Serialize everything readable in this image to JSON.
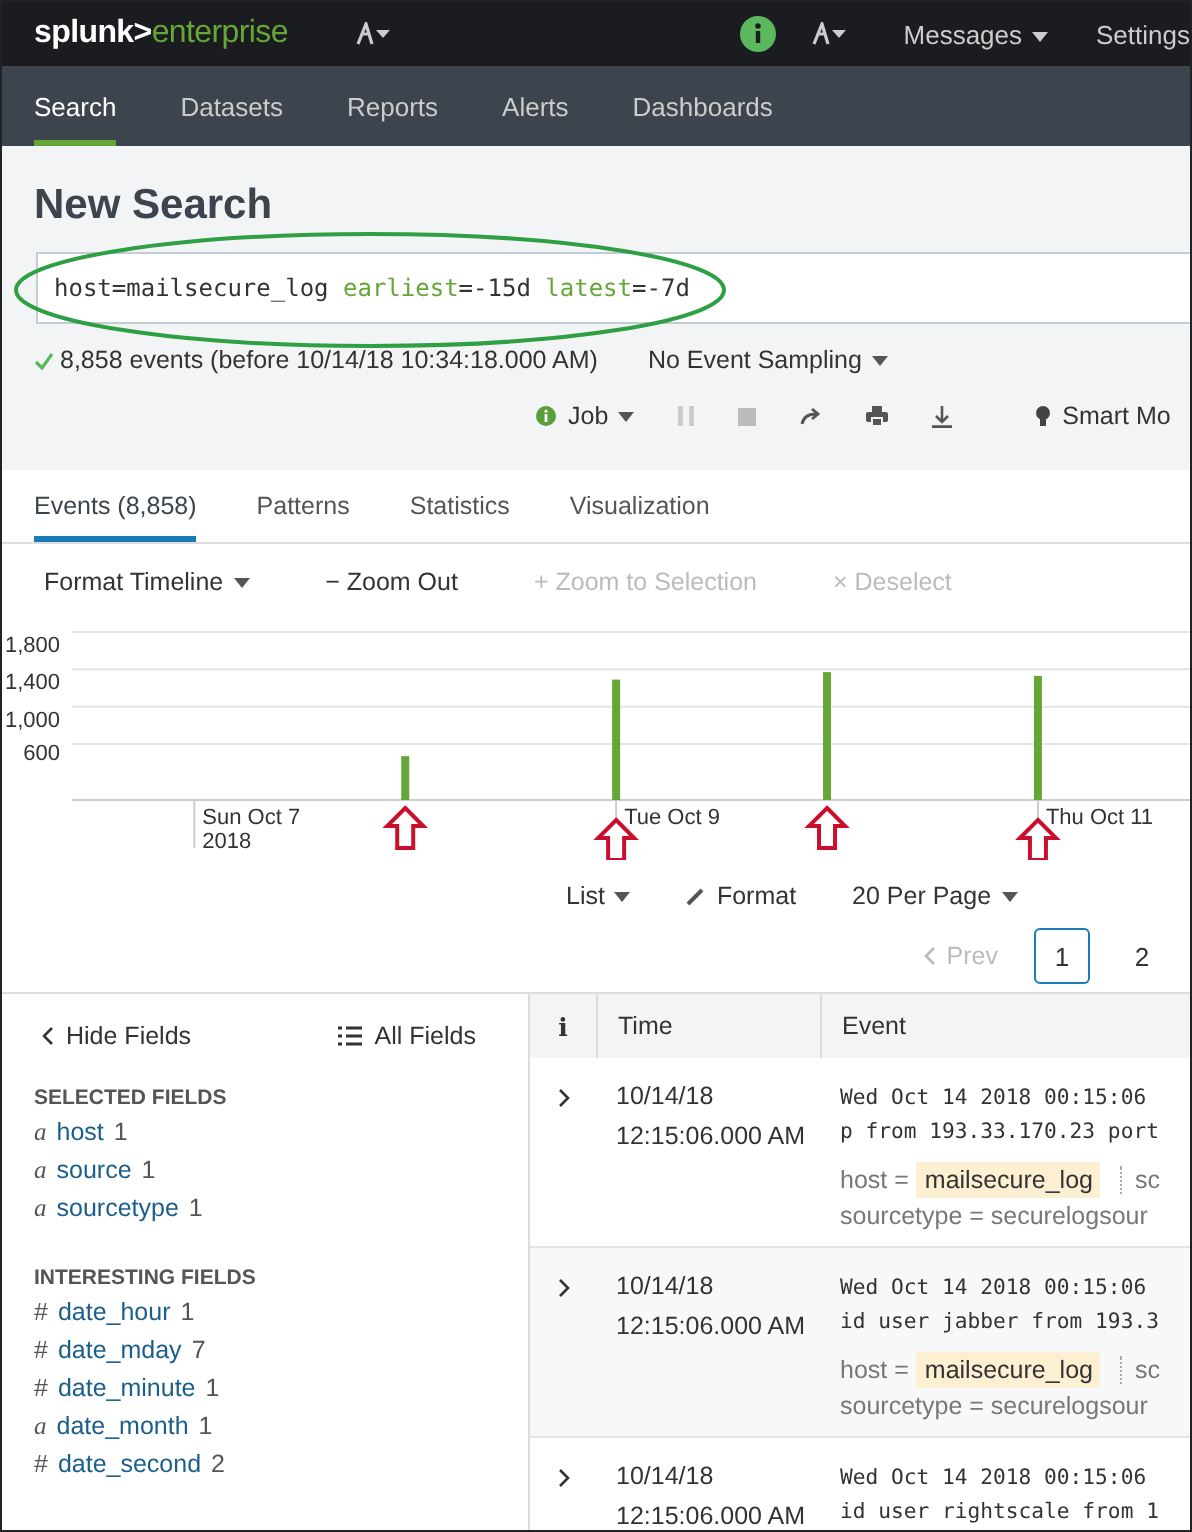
{
  "topbar": {
    "logo_left": "splunk>",
    "logo_right": "enterprise",
    "menus": [
      {
        "label": "Messages",
        "dropdown": true
      },
      {
        "label": "Settings",
        "dropdown": false
      }
    ]
  },
  "nav": [
    {
      "label": "Search",
      "selected": true
    },
    {
      "label": "Datasets",
      "selected": false
    },
    {
      "label": "Reports",
      "selected": false
    },
    {
      "label": "Alerts",
      "selected": false
    },
    {
      "label": "Dashboards",
      "selected": false
    }
  ],
  "page_title": "New Search",
  "search": [
    {
      "text": "host=mailsecure_log ",
      "kind": "plain"
    },
    {
      "text": "earliest",
      "kind": "keyword"
    },
    {
      "text": "=-15d ",
      "kind": "plain"
    },
    {
      "text": "latest",
      "kind": "keyword"
    },
    {
      "text": "=-7d",
      "kind": "plain"
    }
  ],
  "status": {
    "summary": "8,858 events (before 10/14/18 10:34:18.000 AM)",
    "sampling": "No Event Sampling"
  },
  "job": {
    "label": "Job",
    "mode": "Smart Mo"
  },
  "result_tabs": [
    {
      "label": "Events (8,858)",
      "selected": true
    },
    {
      "label": "Patterns",
      "selected": false
    },
    {
      "label": "Statistics",
      "selected": false
    },
    {
      "label": "Visualization",
      "selected": false
    }
  ],
  "timeline_toolbar": [
    {
      "label": "Format Timeline",
      "kind": "menu",
      "disabled": false
    },
    {
      "label": "− Zoom Out",
      "kind": "action",
      "disabled": false
    },
    {
      "label": "+ Zoom to Selection",
      "kind": "action",
      "disabled": true
    },
    {
      "label": "× Deselect",
      "kind": "action",
      "disabled": true
    }
  ],
  "chart_data": {
    "type": "bar",
    "categories": [
      "Sun Oct 7\n2018",
      null,
      "Tue Oct 9",
      null,
      "Thu Oct 11"
    ],
    "values": [
      null,
      470,
      1290,
      1370,
      1330
    ],
    "ylim": [
      0,
      1800
    ],
    "grid": true,
    "yticks": [
      {
        "value": 600,
        "label": "600"
      },
      {
        "value": 1000,
        "label": "1,000"
      },
      {
        "value": 1400,
        "label": "1,400"
      },
      {
        "value": 1800,
        "label": "1,800"
      }
    ]
  },
  "results_toolbar": {
    "view": "List",
    "format": "Format",
    "per_page": "20 Per Page"
  },
  "pagination": {
    "prev": "Prev",
    "prev_disabled": true,
    "pages": [
      {
        "label": "1",
        "selected": true
      },
      {
        "label": "2",
        "selected": false
      }
    ]
  },
  "fields_panel": {
    "hide": "Hide Fields",
    "all": "All Fields",
    "sections": [
      {
        "title": "SELECTED FIELDS",
        "fields": [
          {
            "type": "a",
            "name": "host",
            "count": "1"
          },
          {
            "type": "a",
            "name": "source",
            "count": "1"
          },
          {
            "type": "a",
            "name": "sourcetype",
            "count": "1"
          }
        ]
      },
      {
        "title": "INTERESTING FIELDS",
        "fields": [
          {
            "type": "#",
            "name": "date_hour",
            "count": "1"
          },
          {
            "type": "#",
            "name": "date_mday",
            "count": "7"
          },
          {
            "type": "#",
            "name": "date_minute",
            "count": "1"
          },
          {
            "type": "a",
            "name": "date_month",
            "count": "1"
          },
          {
            "type": "#",
            "name": "date_second",
            "count": "2"
          }
        ]
      }
    ]
  },
  "events": {
    "columns": [
      "i",
      "Time",
      "Event"
    ],
    "rows": [
      {
        "date": "10/14/18",
        "time": "12:15:06.000 AM",
        "lines": [
          "Wed Oct 14 2018 00:15:06",
          "p from 193.33.170.23 port"
        ],
        "host_key": "host =",
        "host_value": "mailsecure_log",
        "next_field": "sc",
        "sourcetype": "sourcetype = securelogsour"
      },
      {
        "date": "10/14/18",
        "time": "12:15:06.000 AM",
        "lines": [
          "Wed Oct 14 2018 00:15:06",
          "id user jabber from 193.3"
        ],
        "host_key": "host =",
        "host_value": "mailsecure_log",
        "next_field": "sc",
        "sourcetype": "sourcetype = securelogsour"
      },
      {
        "date": "10/14/18",
        "time": "12:15:06.000 AM",
        "lines": [
          "Wed Oct 14 2018 00:15:06",
          "id user rightscale from 1"
        ]
      }
    ]
  }
}
